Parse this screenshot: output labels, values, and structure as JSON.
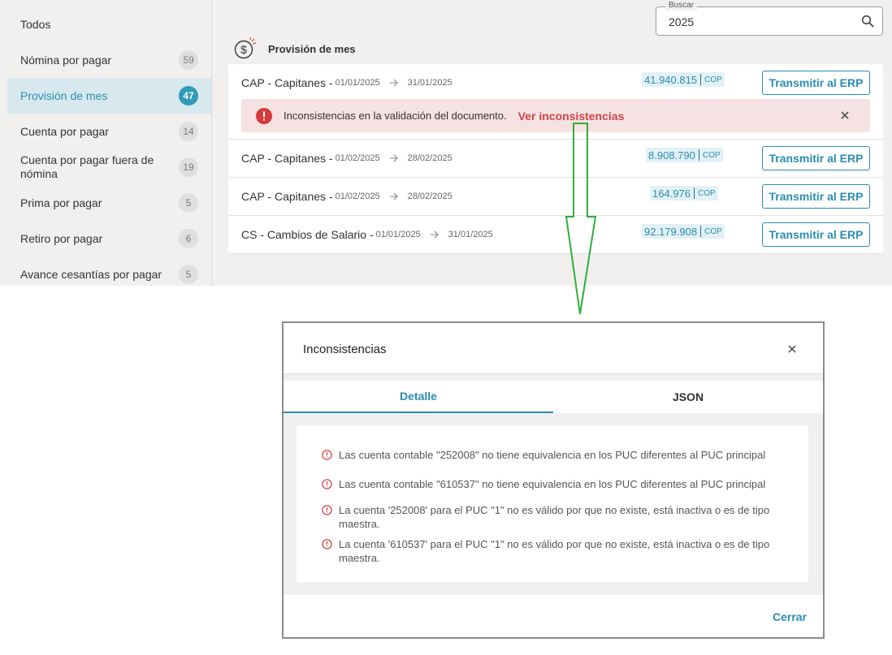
{
  "sidebar": {
    "items": [
      {
        "label": "Todos",
        "count": ""
      },
      {
        "label": "Nómina por pagar",
        "count": "59"
      },
      {
        "label": "Provisión de mes",
        "count": "47"
      },
      {
        "label": "Cuenta por pagar",
        "count": "14"
      },
      {
        "label": "Cuenta por pagar fuera de nómina",
        "count": "19"
      },
      {
        "label": "Prima por pagar",
        "count": "5"
      },
      {
        "label": "Retiro por pagar",
        "count": "6"
      },
      {
        "label": "Avance cesantías por pagar",
        "count": "5"
      }
    ],
    "active_index": 2
  },
  "search": {
    "legend": "Buscar",
    "value": "2025",
    "icon": "search-icon"
  },
  "section": {
    "title": "Provisión de mes",
    "icon": "dollar-circle-icon"
  },
  "rows": [
    {
      "name": "CAP - Capitanes -",
      "date_from": "01/01/2025",
      "date_to": "31/01/2025",
      "amount": "41.940.815",
      "currency": "COP",
      "button": "Transmitir al ERP"
    },
    {
      "name": "CAP - Capitanes -",
      "date_from": "01/02/2025",
      "date_to": "28/02/2025",
      "amount": "8.908.790",
      "currency": "COP",
      "button": "Transmitir al ERP"
    },
    {
      "name": "CAP - Capitanes -",
      "date_from": "01/02/2025",
      "date_to": "28/02/2025",
      "amount": "164.976",
      "currency": "COP",
      "button": "Transmitir al ERP"
    },
    {
      "name": "CS - Cambios de Salario -",
      "date_from": "01/01/2025",
      "date_to": "31/01/2025",
      "amount": "92.179.908",
      "currency": "COP",
      "button": "Transmitir al ERP"
    }
  ],
  "error_banner": {
    "message": "Inconsistencias en la validación del documento.",
    "link": "Ver inconsistencias"
  },
  "modal": {
    "title": "Inconsistencias",
    "tabs": [
      "Detalle",
      "JSON"
    ],
    "active_tab": 0,
    "issues": [
      "Las cuenta contable \"252008\" no tiene equivalencia en los PUC diferentes al PUC principal",
      "Las cuenta contable \"610537\" no tiene equivalencia en los PUC diferentes al PUC principal",
      "La cuenta '252008' para el PUC \"1\" no es válido por que no existe, está inactiva o es de tipo maestra.",
      "La cuenta '610537' para el PUC \"1\" no es válido por que no existe, está inactiva o es de tipo maestra."
    ],
    "close_label": "Cerrar"
  },
  "colors": {
    "accent": "#2a8db0",
    "error": "#d14545",
    "annotation": "#2fae3c"
  }
}
